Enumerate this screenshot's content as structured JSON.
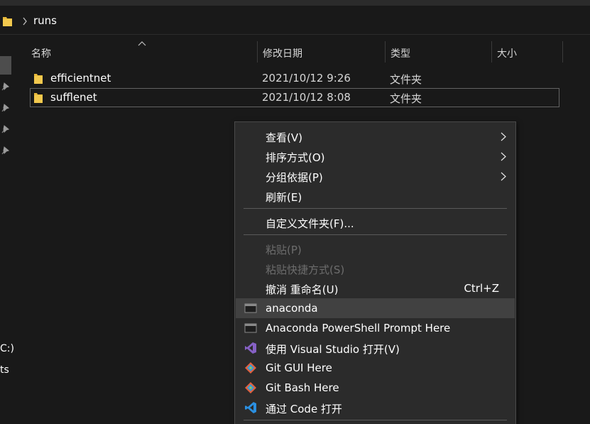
{
  "address": {
    "crumbs": [
      "runs"
    ],
    "folder_icon": "folder-icon",
    "chevron_icon": "chevron-right-icon"
  },
  "nav": {
    "fragments": [
      "C:)",
      "ts"
    ],
    "pin_icon": "pin-icon"
  },
  "columns": {
    "name": "名称",
    "modified": "修改日期",
    "type": "类型",
    "size": "大小",
    "sort_icon": "sort-ascending-icon"
  },
  "files": [
    {
      "name": "efficientnet",
      "modified": "2021/10/12 9:26",
      "type": "文件夹",
      "icon": "folder-icon"
    },
    {
      "name": "sufflenet",
      "modified": "2021/10/12 8:08",
      "type": "文件夹",
      "icon": "folder-icon",
      "selected": true
    }
  ],
  "menu": {
    "items": [
      {
        "label": "查看(V)",
        "submenu": true
      },
      {
        "label": "排序方式(O)",
        "submenu": true
      },
      {
        "label": "分组依据(P)",
        "submenu": true
      },
      {
        "label": "刷新(E)"
      },
      {
        "label": "自定义文件夹(F)..."
      },
      {
        "label": "粘贴(P)",
        "disabled": true
      },
      {
        "label": "粘贴快捷方式(S)",
        "disabled": true
      },
      {
        "label": "撤消 重命名(U)",
        "shortcut": "Ctrl+Z"
      },
      {
        "label": "anaconda",
        "icon": "terminal-icon",
        "highlighted": true
      },
      {
        "label": "Anaconda PowerShell Prompt Here",
        "icon": "terminal-icon"
      },
      {
        "label": "使用 Visual Studio 打开(V)",
        "icon": "visual-studio-icon"
      },
      {
        "label": "Git GUI Here",
        "icon": "git-icon"
      },
      {
        "label": "Git Bash Here",
        "icon": "git-icon"
      },
      {
        "label": "通过 Code 打开",
        "icon": "vscode-icon"
      }
    ]
  },
  "colors": {
    "background": "#191919",
    "menu_bg": "#2b2b2b",
    "menu_hover": "#414141",
    "folder_yellow": "#e8b93a",
    "disabled_text": "#6d6d6d"
  }
}
